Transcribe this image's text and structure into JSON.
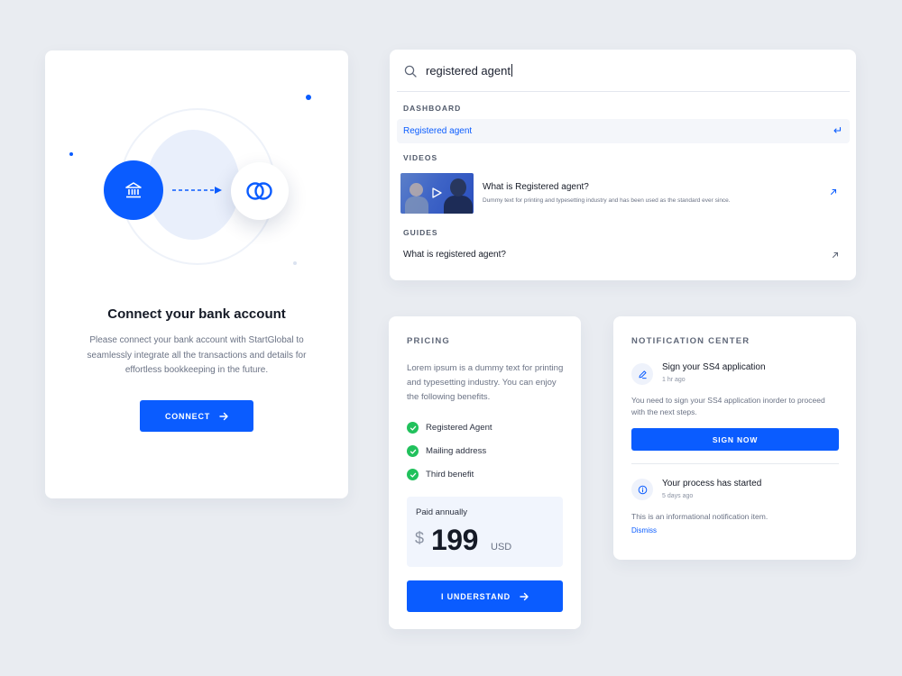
{
  "connect_card": {
    "title": "Connect your bank account",
    "description": "Please connect your bank account with StartGlobal to seamlessly integrate all the transactions and details for effortless bookkeeping in the future.",
    "button_label": "CONNECT",
    "icons": [
      "bank-icon",
      "arrow-right-icon",
      "coins-icon"
    ]
  },
  "search": {
    "query": "registered agent",
    "sections": {
      "dashboard": {
        "label": "DASHBOARD",
        "items": [
          {
            "label": "Registered agent",
            "highlighted": true
          }
        ]
      },
      "videos": {
        "label": "VIDEOS",
        "items": [
          {
            "title": "What is Registered agent?",
            "description": "Dummy text for printing and typesetting industry and has been used as the standard ever since."
          }
        ]
      },
      "guides": {
        "label": "GUIDES",
        "items": [
          {
            "title": "What is registered agent?"
          }
        ]
      }
    }
  },
  "pricing": {
    "label": "PRICING",
    "description": "Lorem ipsum is a dummy text for printing and typesetting industry. You can enjoy the following benefits.",
    "benefits": [
      "Registered Agent",
      "Mailing address",
      "Third benefit"
    ],
    "paid_label": "Paid annually",
    "currency_symbol": "$",
    "amount": "199",
    "currency": "USD",
    "button_label": "I UNDERSTAND"
  },
  "notifications": {
    "label": "NOTIFICATION CENTER",
    "items": [
      {
        "title": "Sign your SS4 application",
        "time": "1 hr ago",
        "body": "You need to sign your SS4 application inorder to proceed with the next steps.",
        "action_label": "SIGN NOW",
        "icon": "pen-icon"
      },
      {
        "title": "Your process has started",
        "time": "5 days ago",
        "body": "This is an informational notification item.",
        "action_label": "Dismiss",
        "icon": "info-icon"
      }
    ]
  },
  "colors": {
    "background": "#e9ecf1",
    "accent": "#0a5cff",
    "success": "#21c15c",
    "text_primary": "#151a26",
    "text_secondary": "#6b7385"
  }
}
